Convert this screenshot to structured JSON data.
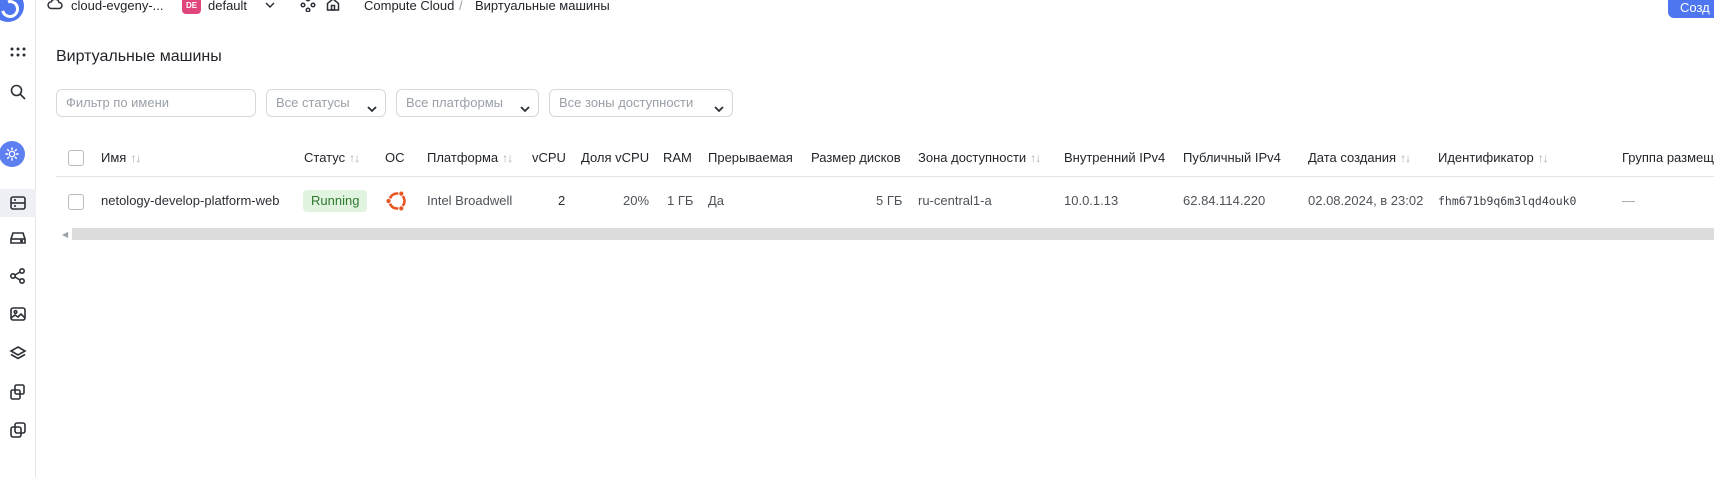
{
  "topbar": {
    "cloud_name": "cloud-evgeny-...",
    "folder_badge": "DE",
    "folder_name": "default",
    "breadcrumb_service": "Compute Cloud",
    "breadcrumb_separator": "/",
    "breadcrumb_page": "Виртуальные машины",
    "create_button": "Созд"
  },
  "sidebar": {
    "items": [
      "services-grid-icon",
      "search-icon",
      "compute-gear-icon",
      "vm-list-icon",
      "disk-icon",
      "network-icon",
      "image-icon",
      "layers-icon",
      "cube-group-icon",
      "copy-icon"
    ]
  },
  "page": {
    "title": "Виртуальные машины"
  },
  "filters": {
    "name_placeholder": "Фильтр по имени",
    "status": "Все статусы",
    "platform": "Все платформы",
    "zone": "Все зоны доступности"
  },
  "table": {
    "columns": [
      "Имя",
      "Статус",
      "ОС",
      "Платформа",
      "vCPU",
      "Доля vCPU",
      "RAM",
      "Прерываемая",
      "Размер дисков",
      "Зона доступности",
      "Внутренний IPv4",
      "Публичный IPv4",
      "Дата создания",
      "Идентификатор",
      "Группа размещ"
    ],
    "sort_glyph": "↑↓",
    "rows": [
      {
        "name": "netology-develop-platform-web",
        "status": "Running",
        "os": "ubuntu",
        "platform": "Intel Broadwell",
        "vcpu": "2",
        "vcpu_share": "20%",
        "ram": "1 ГБ",
        "preemptible": "Да",
        "disk_size": "5 ГБ",
        "zone": "ru-central1-a",
        "internal_ip": "10.0.1.13",
        "public_ip": "62.84.114.220",
        "created": "02.08.2024, в 23:02",
        "id": "fhm671b9q6m3lqd4ouk0",
        "placement_group": "—"
      }
    ]
  },
  "colors": {
    "accent": "#4d76f0",
    "running_bg": "#e1f4e0",
    "running_text": "#2f7a2f",
    "ubuntu": "#e95420",
    "folder_badge": "#e0457b"
  }
}
